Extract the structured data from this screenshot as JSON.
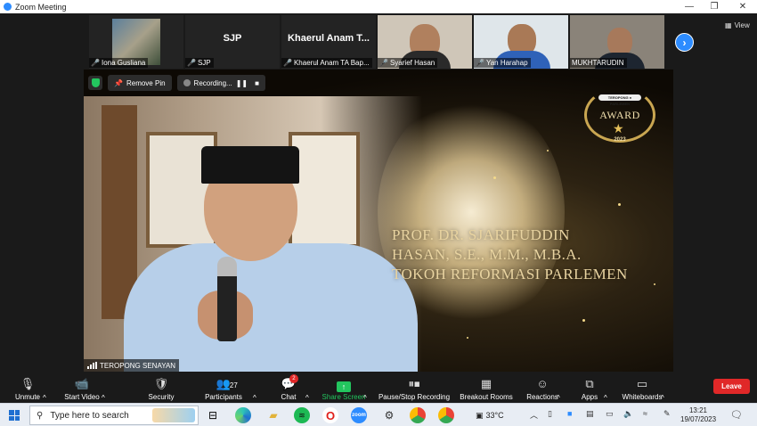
{
  "window": {
    "title": "Zoom Meeting",
    "minimize": "—",
    "restore": "❐",
    "close": "✕"
  },
  "gallery": {
    "participants": [
      {
        "name": "Iona Gusliana",
        "muted": true,
        "display": ""
      },
      {
        "name": "SJP",
        "muted": true,
        "display": "SJP"
      },
      {
        "name": "Khaerul Anam TA Bap...",
        "muted": true,
        "display": "Khaerul Anam T..."
      },
      {
        "name": "Syarief Hasan",
        "muted": true,
        "display": ""
      },
      {
        "name": "Yan Harahap",
        "muted": true,
        "display": ""
      },
      {
        "name": "MUKHTARUDIN",
        "muted": false,
        "display": ""
      }
    ],
    "next_arrow": "›",
    "view_label": "View",
    "view_icon": "grid-icon"
  },
  "main_video": {
    "remove_pin_label": "Remove Pin",
    "recording_label": "Recording...",
    "pause_icon": "❚❚",
    "stop_icon": "■",
    "speaker_label": "TEROPONG SENAYAN",
    "award": {
      "pill_text": "TEROPONG ● PARLEMEN",
      "title": "AWARD",
      "year": "2023"
    },
    "caption_lines": [
      "PROF. DR. SJARIFUDDIN",
      "HASAN, S.E., M.M., M.B.A.",
      "TOKOH REFORMASI PARLEMEN"
    ]
  },
  "toolbar": {
    "unmute": "Unmute",
    "start_video": "Start Video",
    "security": "Security",
    "participants": "Participants",
    "participants_count": "27",
    "chat": "Chat",
    "chat_badge": "2",
    "share_screen": "Share Screen",
    "pause_stop_recording": "Pause/Stop Recording",
    "breakout_rooms": "Breakout Rooms",
    "reactions": "Reactions",
    "apps": "Apps",
    "whiteboards": "Whiteboards",
    "leave": "Leave",
    "caret": "^"
  },
  "taskbar": {
    "search_placeholder": "Type here to search",
    "temperature": "33°C",
    "time": "13:21",
    "date": "19/07/2023",
    "accent": "#1f6fd1"
  }
}
